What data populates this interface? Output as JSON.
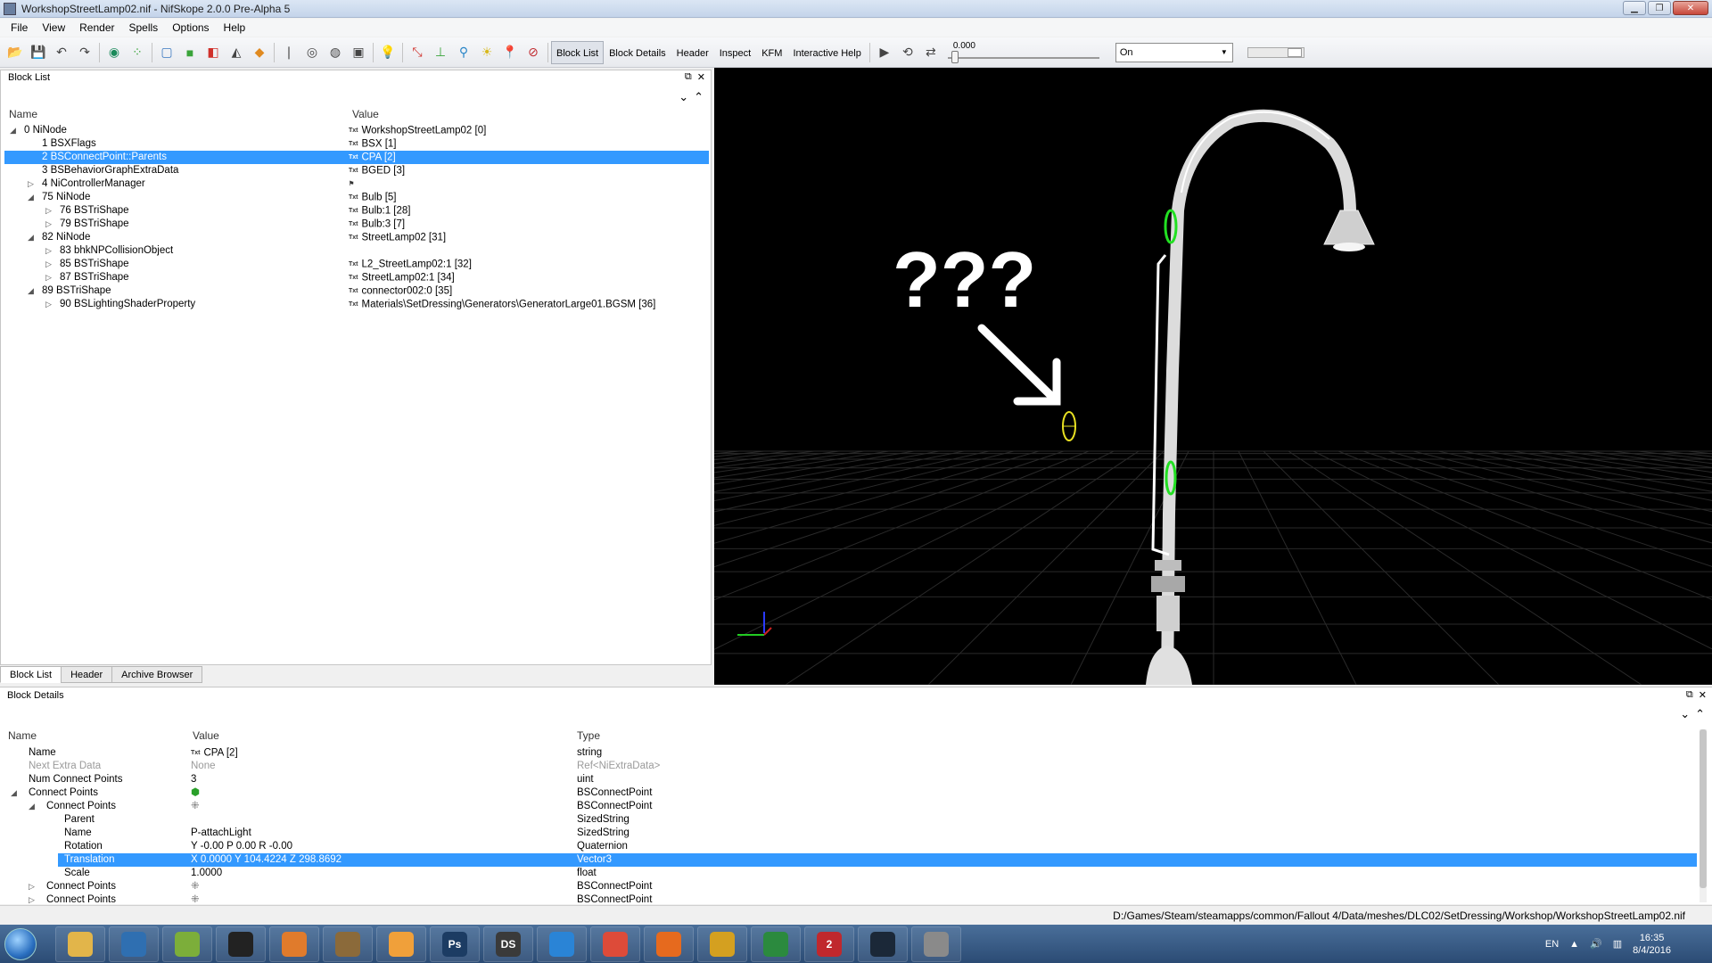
{
  "window": {
    "title": "WorkshopStreetLamp02.nif - NifSkope 2.0.0 Pre-Alpha 5"
  },
  "menu": [
    "File",
    "View",
    "Render",
    "Spells",
    "Options",
    "Help"
  ],
  "toolbar": {
    "buttons": [
      "Block List",
      "Block Details",
      "Header",
      "Inspect",
      "KFM",
      "Interactive Help"
    ],
    "time_value": "0.000",
    "mode_select": "On"
  },
  "block_list": {
    "title": "Block List",
    "col_name": "Name",
    "col_value": "Value",
    "rows": [
      {
        "name": "0 NiNode",
        "value": "WorkshopStreetLamp02 [0]",
        "level": 0,
        "exp": "open",
        "txt": true
      },
      {
        "name": "1 BSXFlags",
        "value": "BSX [1]",
        "level": 1,
        "exp": "",
        "txt": true
      },
      {
        "name": "2 BSConnectPoint::Parents",
        "value": "CPA [2]",
        "level": 1,
        "exp": "",
        "txt": true,
        "selected": true
      },
      {
        "name": "3 BSBehaviorGraphExtraData",
        "value": "BGED [3]",
        "level": 1,
        "exp": "",
        "txt": true
      },
      {
        "name": "4 NiControllerManager",
        "value": "",
        "level": 1,
        "exp": "closed",
        "txt": false
      },
      {
        "name": "75 NiNode",
        "value": "Bulb [5]",
        "level": 1,
        "exp": "open",
        "txt": true
      },
      {
        "name": "76 BSTriShape",
        "value": "Bulb:1 [28]",
        "level": 2,
        "exp": "closed",
        "txt": true
      },
      {
        "name": "79 BSTriShape",
        "value": "Bulb:3 [7]",
        "level": 2,
        "exp": "closed",
        "txt": true
      },
      {
        "name": "82 NiNode",
        "value": "StreetLamp02 [31]",
        "level": 1,
        "exp": "open",
        "txt": true
      },
      {
        "name": "83 bhkNPCollisionObject",
        "value": "",
        "level": 2,
        "exp": "closed",
        "txt": false
      },
      {
        "name": "85 BSTriShape",
        "value": "L2_StreetLamp02:1 [32]",
        "level": 2,
        "exp": "closed",
        "txt": true
      },
      {
        "name": "87 BSTriShape",
        "value": "StreetLamp02:1 [34]",
        "level": 2,
        "exp": "closed",
        "txt": true
      },
      {
        "name": "89 BSTriShape",
        "value": "connector002:0 [35]",
        "level": 1,
        "exp": "open",
        "txt": true
      },
      {
        "name": "90 BSLightingShaderProperty",
        "value": "Materials\\SetDressing\\Generators\\GeneratorLarge01.BGSM [36]",
        "level": 2,
        "exp": "closed",
        "txt": true
      }
    ],
    "tabs": [
      "Block List",
      "Header",
      "Archive Browser"
    ]
  },
  "viewport": {
    "annotation": "???"
  },
  "block_details": {
    "title": "Block Details",
    "col_name": "Name",
    "col_value": "Value",
    "col_type": "Type",
    "rows": [
      {
        "name": "Name",
        "value": "CPA [2]",
        "type": "string",
        "level": 1,
        "exp": "",
        "txt": true
      },
      {
        "name": "Next Extra Data",
        "value": "None",
        "type": "Ref<NiExtraData>",
        "level": 1,
        "exp": "",
        "grey": true
      },
      {
        "name": "Num Connect Points",
        "value": "3",
        "type": "uint",
        "level": 1,
        "exp": ""
      },
      {
        "name": "Connect Points",
        "value": "",
        "type": "BSConnectPoint",
        "level": 1,
        "exp": "open"
      },
      {
        "name": "Connect Points",
        "value": "",
        "type": "BSConnectPoint",
        "level": 2,
        "exp": "open"
      },
      {
        "name": "Parent",
        "value": "",
        "type": "SizedString",
        "level": 3,
        "exp": ""
      },
      {
        "name": "Name",
        "value": "P-attachLight",
        "type": "SizedString",
        "level": 3,
        "exp": ""
      },
      {
        "name": "Rotation",
        "value": "Y -0.00 P 0.00 R -0.00",
        "type": "Quaternion",
        "level": 3,
        "exp": ""
      },
      {
        "name": "Translation",
        "value": "X 0.0000 Y 104.4224 Z 298.8692",
        "type": "Vector3",
        "level": 3,
        "exp": "",
        "selected": true
      },
      {
        "name": "Scale",
        "value": "1.0000",
        "type": "float",
        "level": 3,
        "exp": ""
      },
      {
        "name": "Connect Points",
        "value": "",
        "type": "BSConnectPoint",
        "level": 2,
        "exp": "closed"
      },
      {
        "name": "Connect Points",
        "value": "",
        "type": "BSConnectPoint",
        "level": 2,
        "exp": "closed"
      }
    ]
  },
  "status": {
    "path": "D:/Games/Steam/steamapps/common/Fallout 4/Data/meshes/DLC02/SetDressing/Workshop/WorkshopStreetLamp02.nif"
  },
  "taskbar": {
    "apps": [
      {
        "icon": "folder-icon",
        "label": "",
        "color": "#e2b54a"
      },
      {
        "icon": "thunderbird-icon",
        "label": "",
        "color": "#2f6fb1"
      },
      {
        "icon": "chart-app-icon",
        "label": "",
        "color": "#7cae3a"
      },
      {
        "icon": "media-player-icon",
        "label": "",
        "color": "#222222"
      },
      {
        "icon": "video-app-icon",
        "label": "",
        "color": "#e07b2c"
      },
      {
        "icon": "lightning-app-icon",
        "label": "",
        "color": "#8b6a3a"
      },
      {
        "icon": "photo-app-icon",
        "label": "",
        "color": "#f0a03a"
      },
      {
        "icon": "photoshop-icon",
        "label": "Ps",
        "color": "#1c3c63"
      },
      {
        "icon": "ds-app-icon",
        "label": "DS",
        "color": "#3a3a3a"
      },
      {
        "icon": "internet-explorer-icon",
        "label": "",
        "color": "#2a84d6"
      },
      {
        "icon": "chrome-icon",
        "label": "",
        "color": "#dd4b39"
      },
      {
        "icon": "firefox-icon",
        "label": "",
        "color": "#e66a1e"
      },
      {
        "icon": "crossed-tools-icon",
        "label": "",
        "color": "#d4a020"
      },
      {
        "icon": "utorrent-icon",
        "label": "",
        "color": "#2b8a3e"
      },
      {
        "icon": "app-two-icon",
        "label": "2",
        "color": "#c0282d"
      },
      {
        "icon": "steam-icon",
        "label": "",
        "color": "#1b2838"
      },
      {
        "icon": "nifskope-icon",
        "label": "",
        "color": "#8a8a8a"
      }
    ],
    "lang": "EN",
    "time": "16:35",
    "date": "8/4/2016"
  }
}
